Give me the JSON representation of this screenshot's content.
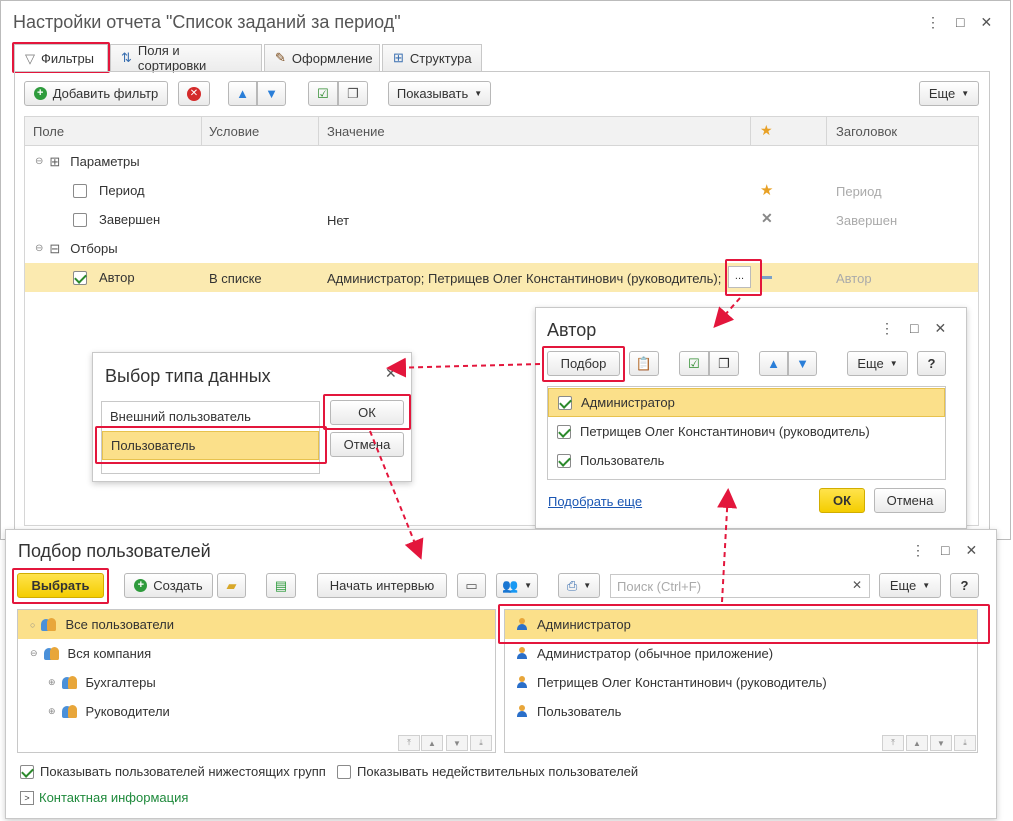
{
  "main": {
    "title": "Настройки отчета \"Список заданий за период\"",
    "tabs": [
      "Фильтры",
      "Поля и сортировки",
      "Оформление",
      "Структура"
    ],
    "toolbar": {
      "add_filter": "Добавить фильтр",
      "show": "Показывать",
      "more": "Еще"
    },
    "columns": {
      "field": "Поле",
      "condition": "Условие",
      "value": "Значение",
      "header": "Заголовок"
    },
    "rows": {
      "params": "Параметры",
      "period": "Период",
      "period_header": "Период",
      "finished": "Завершен",
      "finished_value": "Нет",
      "finished_header": "Завершен",
      "filters": "Отборы",
      "author": "Автор",
      "author_condition": "В списке",
      "author_value": "Администратор; Петрищев Олег Константинович (руководитель);",
      "author_header": "Автор",
      "ellipsis": "..."
    }
  },
  "author_dialog": {
    "title": "Автор",
    "pick": "Подбор",
    "more": "Еще",
    "help": "?",
    "items": [
      "Администратор",
      "Петрищев Олег Константинович (руководитель)",
      "Пользователь"
    ],
    "pick_more": "Подобрать еще",
    "ok": "ОК",
    "cancel": "Отмена"
  },
  "type_dialog": {
    "title": "Выбор типа данных",
    "items": [
      "Внешний пользователь",
      "Пользователь"
    ],
    "ok": "ОК",
    "cancel": "Отмена"
  },
  "users_dialog": {
    "title": "Подбор пользователей",
    "choose": "Выбрать",
    "create": "Создать",
    "interview": "Начать интервью",
    "search_placeholder": "Поиск (Ctrl+F)",
    "more": "Еще",
    "help": "?",
    "groups": [
      "Все пользователи",
      "Вся компания",
      "Бухгалтеры",
      "Руководители"
    ],
    "users": [
      "Администратор",
      "Администратор (обычное приложение)",
      "Петрищев Олег Константинович (руководитель)",
      "Пользователь"
    ],
    "show_subgroups": "Показывать пользователей нижестоящих групп",
    "show_invalid": "Показывать недействительных пользователей",
    "contacts": "Контактная информация"
  },
  "colors": {
    "accent_red": "#e3163c",
    "highlight": "#fbe08a",
    "yellow_button": "#f4cd00"
  }
}
